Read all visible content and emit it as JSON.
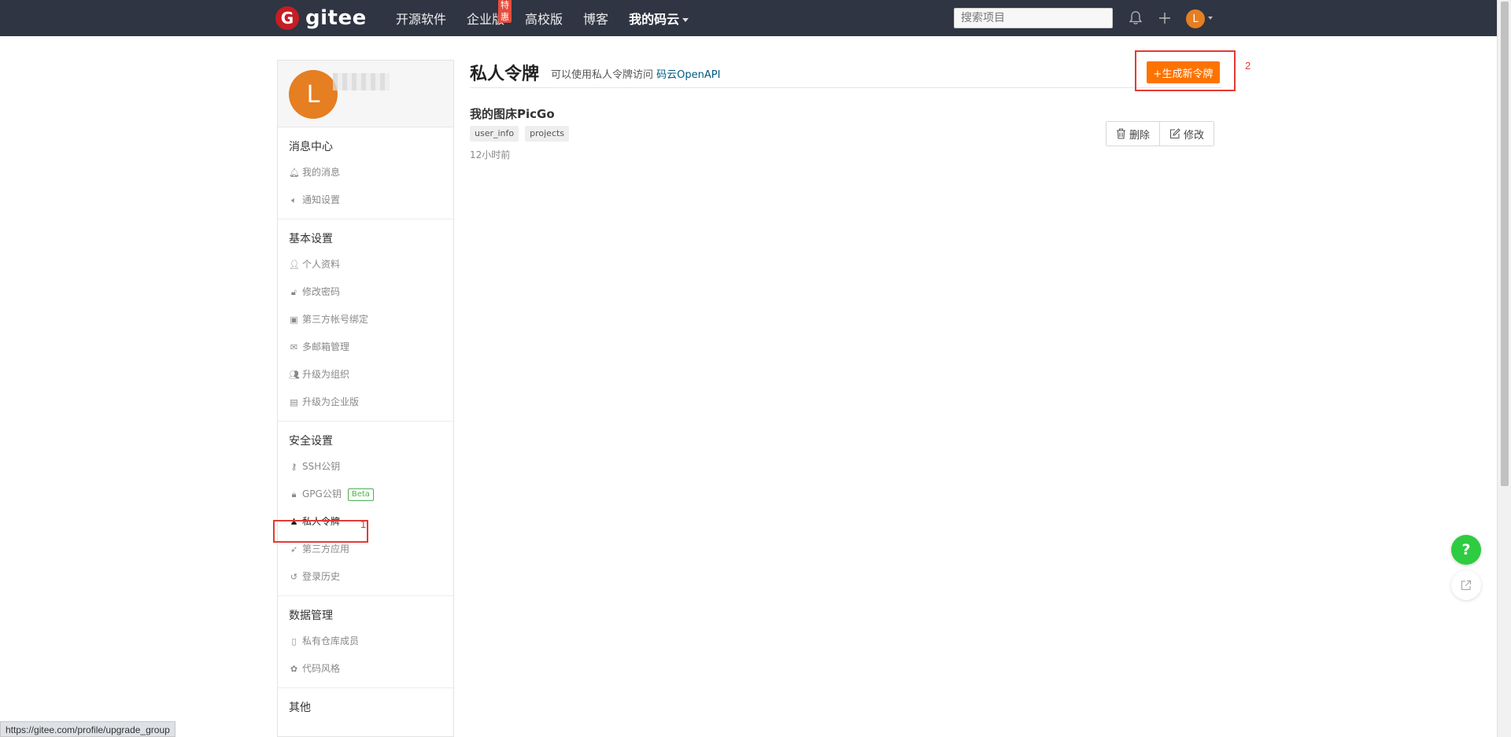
{
  "navbar": {
    "logo_glyph": "G",
    "logo_text": "gitee",
    "links": [
      {
        "label": "开源软件"
      },
      {
        "label": "企业版",
        "badge": "特惠"
      },
      {
        "label": "高校版"
      },
      {
        "label": "博客"
      },
      {
        "label": "我的码云"
      }
    ],
    "search_placeholder": "搜索项目",
    "avatar_letter": "L"
  },
  "sidebar": {
    "avatar_letter": "L",
    "groups": [
      {
        "title": "消息中心",
        "items": [
          {
            "label": "我的消息",
            "icon": "bell-icon"
          },
          {
            "label": "通知设置",
            "icon": "speaker-icon"
          }
        ]
      },
      {
        "title": "基本设置",
        "items": [
          {
            "label": "个人资料",
            "icon": "user-icon"
          },
          {
            "label": "修改密码",
            "icon": "unlock-icon"
          },
          {
            "label": "第三方帐号绑定",
            "icon": "id-card-icon"
          },
          {
            "label": "多邮箱管理",
            "icon": "mail-icon"
          },
          {
            "label": "升级为组织",
            "icon": "users-icon"
          },
          {
            "label": "升级为企业版",
            "icon": "building-icon"
          }
        ]
      },
      {
        "title": "安全设置",
        "items": [
          {
            "label": "SSH公钥",
            "icon": "key-icon"
          },
          {
            "label": "GPG公钥",
            "icon": "lock-icon",
            "badge": "Beta"
          },
          {
            "label": "私人令牌",
            "icon": "user-secret-icon",
            "active": true
          },
          {
            "label": "第三方应用",
            "icon": "rocket-icon"
          },
          {
            "label": "登录历史",
            "icon": "history-icon"
          }
        ]
      },
      {
        "title": "数据管理",
        "items": [
          {
            "label": "私有仓库成员",
            "icon": "clipboard-icon"
          },
          {
            "label": "代码风格",
            "icon": "palette-icon"
          }
        ]
      },
      {
        "title": "其他",
        "items": []
      }
    ]
  },
  "main": {
    "title": "私人令牌",
    "desc_prefix": "可以使用私人令牌访问",
    "desc_link": "码云OpenAPI",
    "generate_button": "+生成新令牌",
    "token": {
      "name": "我的图床PicGo",
      "scopes": [
        "user_info",
        "projects"
      ],
      "time": "12小时前",
      "delete_label": "删除",
      "edit_label": "修改"
    }
  },
  "annotations": {
    "step1": "1",
    "step2": "2"
  },
  "floating": {
    "help": "?"
  },
  "status_url": "https://gitee.com/profile/upgrade_group",
  "colors": {
    "navbar_bg": "#2f3542",
    "brand_red": "#c71d23",
    "primary_orange": "#fe7300",
    "avatar_orange": "#e67e22",
    "help_green": "#2ecc40",
    "annotation_red": "#e53935"
  }
}
